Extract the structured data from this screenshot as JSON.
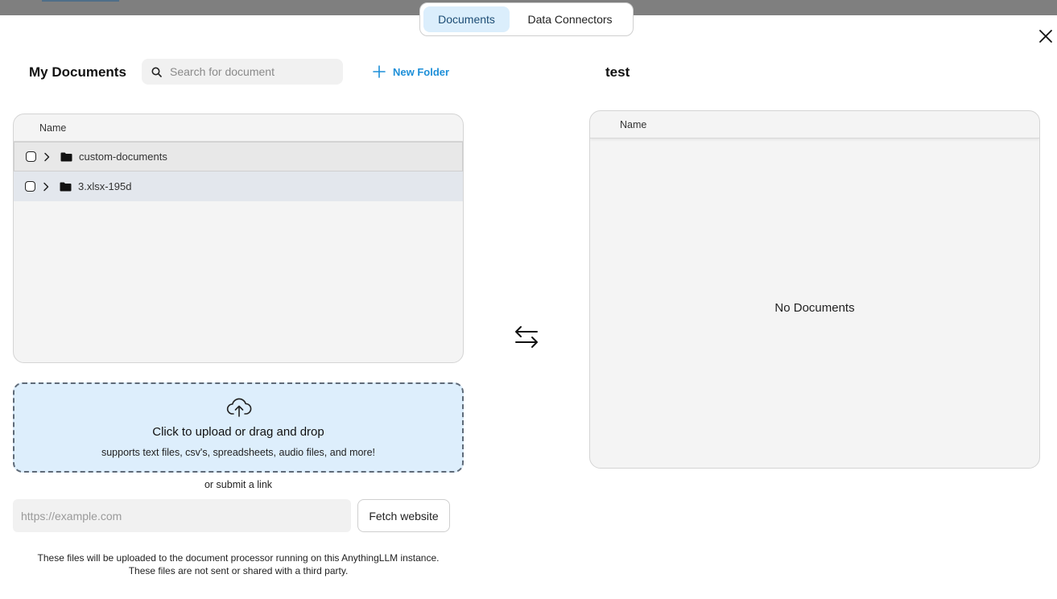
{
  "tabs": [
    {
      "label": "Documents",
      "active": true
    },
    {
      "label": "Data Connectors",
      "active": false
    }
  ],
  "my_documents": {
    "title": "My Documents",
    "search_placeholder": "Search for document",
    "new_folder_label": "New Folder",
    "column_name": "Name",
    "rows": [
      {
        "name": "custom-documents",
        "type": "folder"
      },
      {
        "name": "3.xlsx-195d",
        "type": "folder"
      }
    ]
  },
  "workspace": {
    "title": "test",
    "column_name": "Name",
    "empty_text": "No Documents"
  },
  "upload": {
    "title": "Click to upload or drag and drop",
    "subtitle": "supports text files, csv's, spreadsheets, audio files, and more!",
    "or_link": "or submit a link",
    "url_placeholder": "https://example.com",
    "fetch_label": "Fetch website",
    "disclaimer_line1": "These files will be uploaded to the document processor running on this AnythingLLM instance.",
    "disclaimer_line2": "These files are not sent or shared with a third party."
  },
  "colors": {
    "accent": "#1d8fd8",
    "active_tab_bg": "#dbeefc",
    "dropzone_bg": "#ddeefc",
    "panel_bg": "#f4f4f4"
  },
  "icons": {
    "close": "close-icon",
    "search": "search-icon",
    "new_folder": "plus-icon",
    "swap": "swap-arrows-icon",
    "upload": "cloud-upload-icon",
    "folder": "folder-icon",
    "chevron": "chevron-right-icon"
  }
}
